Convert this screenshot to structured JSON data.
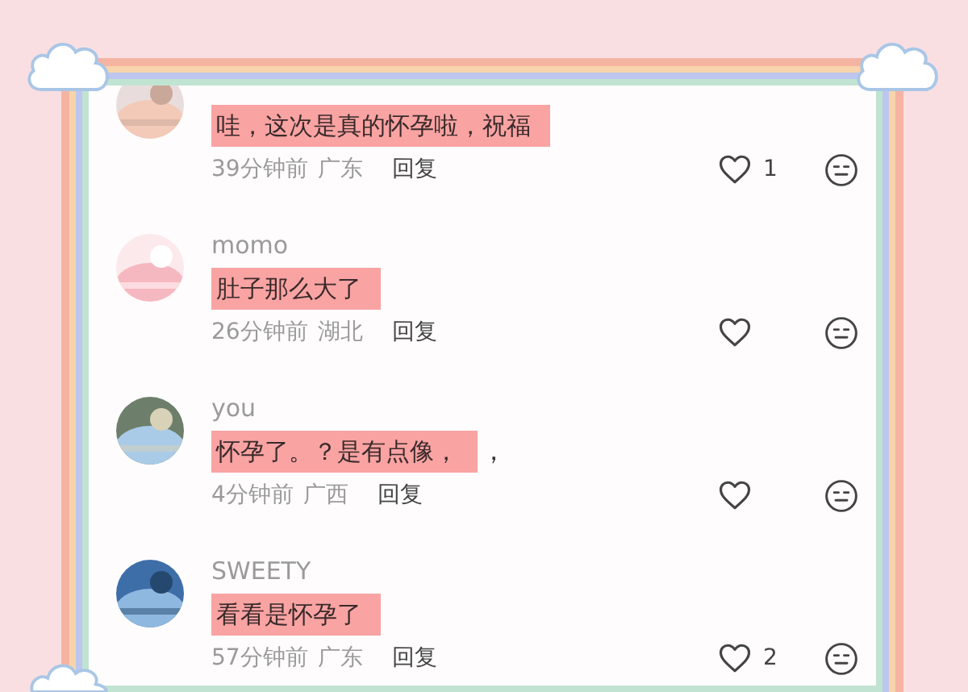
{
  "comments": [
    {
      "text": "哇，这次是真的怀孕啦，祝福",
      "time": "39分钟前",
      "location": "广东",
      "reply": "回复",
      "likes": "1"
    },
    {
      "name": "momo",
      "text": "肚子那么大了",
      "time": "26分钟前",
      "location": "湖北",
      "reply": "回复"
    },
    {
      "name": "you",
      "text": "怀孕了。？是有点像，",
      "trailing": "，",
      "time": "4分钟前",
      "location": "广西",
      "reply": "回复"
    },
    {
      "name": "SWEETY",
      "text": "看看是怀孕了",
      "time": "57分钟前",
      "location": "广东",
      "reply": "回复",
      "likes": "2"
    }
  ]
}
